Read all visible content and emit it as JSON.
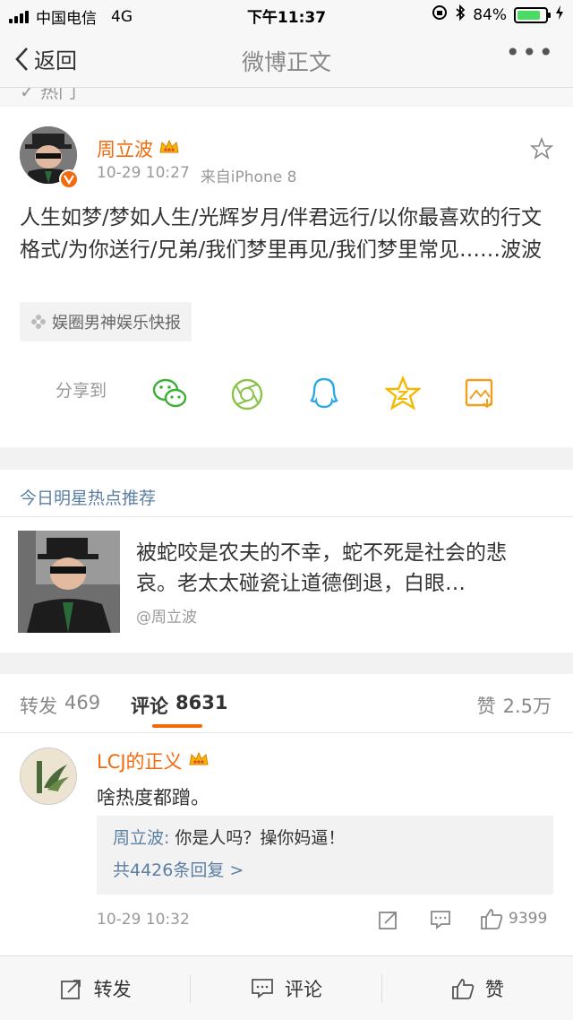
{
  "status_bar": {
    "carrier": "中国电信",
    "network": "4G",
    "time": "下午11:37",
    "battery": "84%",
    "battery_level": 0.84
  },
  "nav": {
    "back_label": "返回",
    "title": "微博正文",
    "more": "•••"
  },
  "partial_strip_text": "✓ 热门",
  "post": {
    "author": "周立波",
    "timestamp": "10-29 10:27",
    "source": "来自iPhone 8",
    "text": "人生如梦/梦如人生/光辉岁月/伴君远行/以你最喜欢的行文格式/为你送行/兄弟/我们梦里再见/我们梦里常见……波波",
    "tag": "娱圈男神娱乐快报",
    "share_label": "分享到"
  },
  "recommendation": {
    "section_title": "今日明星热点推荐",
    "text": "被蛇咬是农夫的不幸，蛇不死是社会的悲哀。老太太碰瓷让道德倒退，白眼…",
    "handle": "@周立波"
  },
  "tabs": {
    "repost_label": "转发",
    "repost_count": "469",
    "comment_label": "评论",
    "comment_count": "8631",
    "like_label": "赞",
    "like_count": "2.5万"
  },
  "comment": {
    "author": "LCJ的正义",
    "text": "啥热度都蹭。",
    "reply_author": "周立波:",
    "reply_text": "你是人吗？操你妈逼！",
    "reply_more": "共4426条回复 >",
    "timestamp": "10-29 10:32",
    "like_count": "9399"
  },
  "bottom_bar": {
    "repost": "转发",
    "comment": "评论",
    "like": "赞"
  },
  "colors": {
    "accent": "#f36a0c",
    "link": "#5b7fa3",
    "wechat": "#3cb034",
    "moments": "#8bc34a",
    "qq": "#2fa9e6",
    "qzone": "#f5b800",
    "weibo_orange": "#f0a020"
  }
}
